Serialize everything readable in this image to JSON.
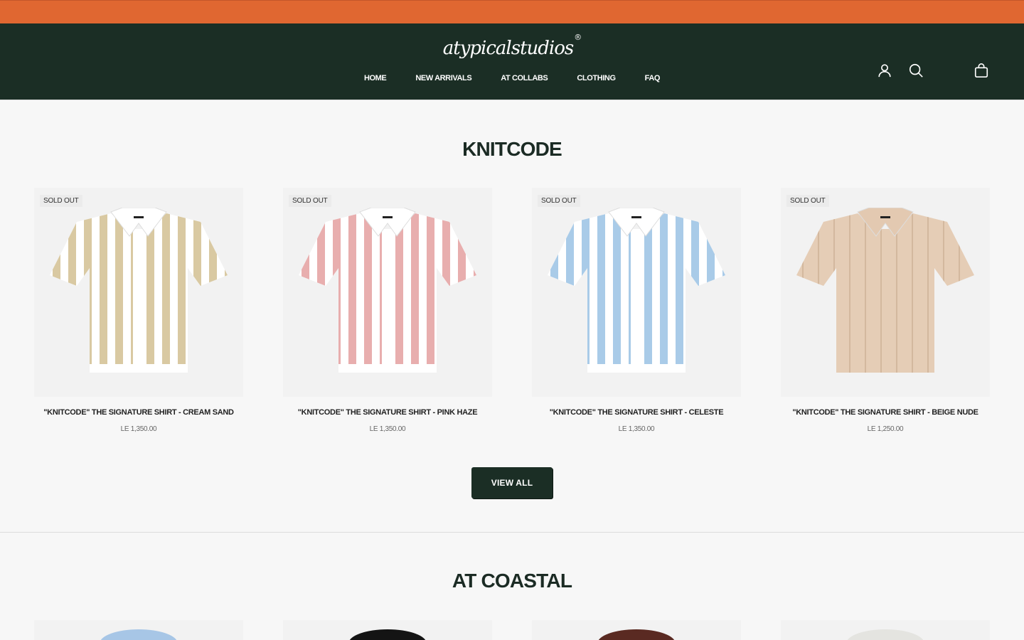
{
  "header": {
    "logo": "atypicalstudios",
    "logo_mark": "®",
    "nav": [
      "HOME",
      "NEW ARRIVALS",
      "AT COLLABS",
      "CLOTHING",
      "FAQ"
    ],
    "icons": [
      "account-icon",
      "search-icon",
      "bag-icon"
    ]
  },
  "section1": {
    "title": "KNITCODE",
    "products": [
      {
        "badge": "SOLD OUT",
        "name": "\"KNITCODE\" THE SIGNATURE SHIRT - CREAM SAND",
        "price": "LE 1,350.00",
        "stripe": "#d9c9a2",
        "base": "#ffffff"
      },
      {
        "badge": "SOLD OUT",
        "name": "\"KNITCODE\" THE SIGNATURE SHIRT - PINK HAZE",
        "price": "LE 1,350.00",
        "stripe": "#e8aeae",
        "base": "#ffffff"
      },
      {
        "badge": "SOLD OUT",
        "name": "\"KNITCODE\" THE SIGNATURE SHIRT - CELESTE",
        "price": "LE 1,350.00",
        "stripe": "#a9cbe8",
        "base": "#ffffff"
      },
      {
        "badge": "SOLD OUT",
        "name": "\"KNITCODE\" THE SIGNATURE SHIRT - BEIGE NUDE",
        "price": "LE 1,250.00",
        "stripe": "#e5cdb6",
        "base": "#e5cdb6"
      }
    ],
    "view_all": "VIEW ALL"
  },
  "section2": {
    "title": "AT COASTAL",
    "products": [
      {
        "color": "#a7c6e6"
      },
      {
        "color": "#141414"
      },
      {
        "color": "#5a2a22"
      },
      {
        "color": "#e4e4e0"
      }
    ]
  },
  "colors": {
    "topbar": "#e06731",
    "header": "#1b2e25"
  }
}
